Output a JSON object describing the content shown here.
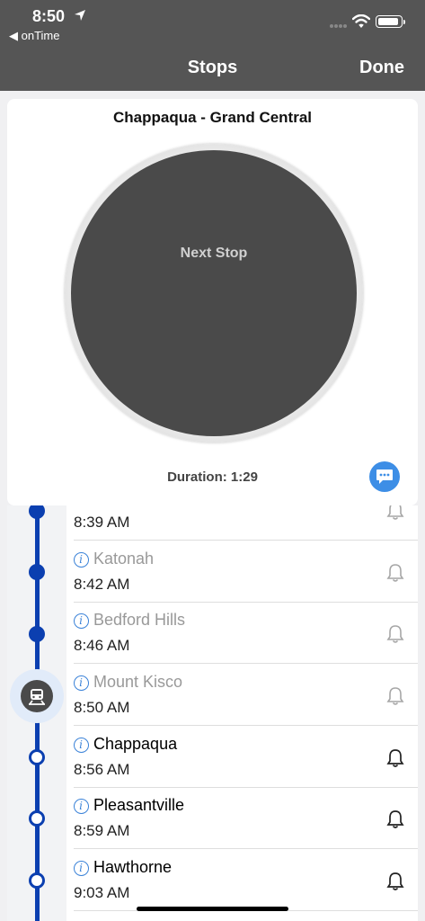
{
  "status_bar": {
    "time": "8:50",
    "back_app": "◀ onTime"
  },
  "nav": {
    "title": "Stops",
    "done_label": "Done"
  },
  "card": {
    "route": "Chappaqua - Grand Central",
    "next_stop_label": "Next Stop",
    "duration": "Duration: 1:29"
  },
  "stops": [
    {
      "name": "",
      "time": "8:39 AM",
      "status": "past",
      "alert": "off"
    },
    {
      "name": "Katonah",
      "time": "8:42 AM",
      "status": "past",
      "alert": "off"
    },
    {
      "name": "Bedford Hills",
      "time": "8:46 AM",
      "status": "past",
      "alert": "off"
    },
    {
      "name": "Mount Kisco",
      "time": "8:50 AM",
      "status": "current",
      "alert": "off"
    },
    {
      "name": "Chappaqua",
      "time": "8:56 AM",
      "status": "upcoming",
      "alert": "on"
    },
    {
      "name": "Pleasantville",
      "time": "8:59 AM",
      "status": "upcoming",
      "alert": "on"
    },
    {
      "name": "Hawthorne",
      "time": "9:03 AM",
      "status": "upcoming",
      "alert": "on"
    }
  ],
  "colors": {
    "nav_bar": "#555555",
    "track": "#0b3fb0",
    "info": "#3a82d8",
    "chat": "#3d8ee6",
    "disc": "#4a4a4a"
  },
  "icons": [
    "location-arrow-icon",
    "signal-icon",
    "wifi-icon",
    "battery-icon",
    "chat-icon",
    "info-icon",
    "bell-icon",
    "train-icon"
  ]
}
